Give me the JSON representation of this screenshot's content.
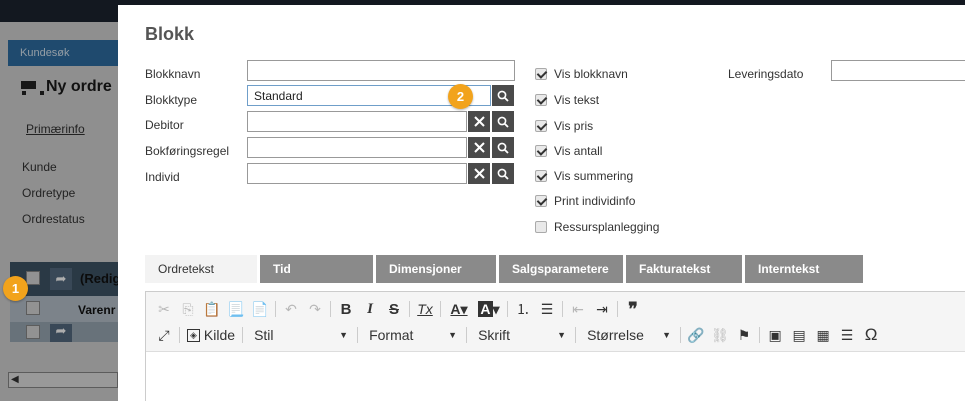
{
  "background": {
    "tab_label": "Kundesøk",
    "order_title": "Ny ordre",
    "primary_link": "Primærinfo",
    "fields": [
      "Kunde",
      "Ordretype",
      "Ordrestatus"
    ],
    "row_label": "(Redig",
    "col_label": "Varenr"
  },
  "modal": {
    "title": "Blokk",
    "form": {
      "blokknavn": {
        "label": "Blokknavn",
        "value": ""
      },
      "blokktype": {
        "label": "Blokktype",
        "value": "Standard"
      },
      "debitor": {
        "label": "Debitor",
        "value": ""
      },
      "bokforingsregel": {
        "label": "Bokføringsregel",
        "value": ""
      },
      "individ": {
        "label": "Individ",
        "value": ""
      },
      "leveringsdato": {
        "label": "Leveringsdato",
        "value": ""
      }
    },
    "checkboxes": [
      {
        "label": "Vis blokknavn",
        "checked": true
      },
      {
        "label": "Vis tekst",
        "checked": true
      },
      {
        "label": "Vis pris",
        "checked": true
      },
      {
        "label": "Vis antall",
        "checked": true
      },
      {
        "label": "Vis summering",
        "checked": true
      },
      {
        "label": "Print individinfo",
        "checked": true
      },
      {
        "label": "Ressursplanlegging",
        "checked": false
      }
    ],
    "tabs": [
      "Ordretekst",
      "Tid",
      "Dimensjoner",
      "Salgsparametere",
      "Fakturatekst",
      "Interntekst"
    ],
    "editor": {
      "kilde": "Kilde",
      "stil": "Stil",
      "format": "Format",
      "skrift": "Skrift",
      "storrelse": "Størrelse",
      "bold": "B",
      "italic": "I",
      "strike": "S",
      "quote": "❞",
      "omega": "Ω"
    }
  },
  "annotations": {
    "badge1": "1",
    "badge2": "2"
  },
  "colors": {
    "accent_badge": "#f2a31c",
    "tab_inactive": "#8a8a8a",
    "button_dark": "#4a4a4a"
  }
}
